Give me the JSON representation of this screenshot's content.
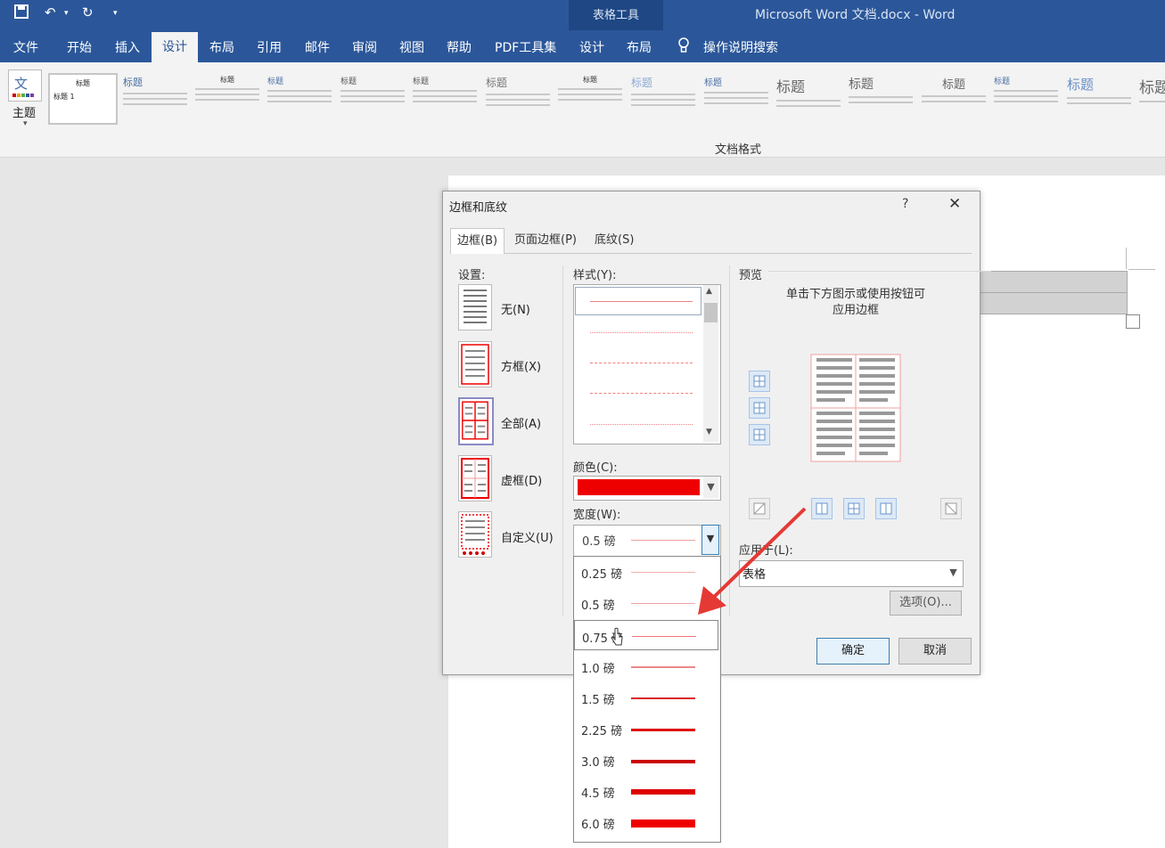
{
  "titlebar": {
    "context_tools": "表格工具",
    "doc_title": "Microsoft Word 文档.docx  -  Word"
  },
  "tabs": {
    "file": "文件",
    "home": "开始",
    "insert": "插入",
    "design": "设计",
    "layout": "布局",
    "references": "引用",
    "mailings": "邮件",
    "review": "审阅",
    "view": "视图",
    "help": "帮助",
    "pdf": "PDF工具集",
    "table_design": "设计",
    "table_layout": "布局",
    "tell_me": "操作说明搜索"
  },
  "ribbon": {
    "theme_label": "主题",
    "first_style_title": "标题",
    "first_style_heading": "标题 1",
    "thumb_titles": [
      "标题",
      "标题",
      "标题",
      "标题",
      "标题",
      "标题",
      "标题",
      "标题",
      "标题",
      "标题",
      "标题",
      "标题",
      "标题",
      "标题",
      "标题",
      "标题"
    ],
    "group_label": "文档格式"
  },
  "dialog": {
    "title": "边框和底纹",
    "help": "?",
    "close": "✕",
    "tabs": [
      "边框(B)",
      "页面边框(P)",
      "底纹(S)"
    ],
    "setting_label": "设置:",
    "settings": [
      "无(N)",
      "方框(X)",
      "全部(A)",
      "虚框(D)",
      "自定义(U)"
    ],
    "style_label": "样式(Y):",
    "color_label": "颜色(C):",
    "color_value": "#ee0000",
    "width_label": "宽度(W):",
    "width_value": "0.5 磅",
    "width_options": [
      "0.25 磅",
      "0.5 磅",
      "0.75 磅",
      "1.0 磅",
      "1.5 磅",
      "2.25 磅",
      "3.0 磅",
      "4.5 磅",
      "6.0 磅"
    ],
    "width_selected_index": 2,
    "preview_label": "预览",
    "preview_hint_line1": "单击下方图示或使用按钮可",
    "preview_hint_line2": "应用边框",
    "apply_label": "应用于(L):",
    "apply_value": "表格",
    "options_button": "选项(O)...",
    "ok_button": "确定",
    "cancel_button": "取消"
  },
  "colors": {
    "title_bar": "#2b579a",
    "border_red": "#ee0000",
    "arrow": "#e53935"
  }
}
